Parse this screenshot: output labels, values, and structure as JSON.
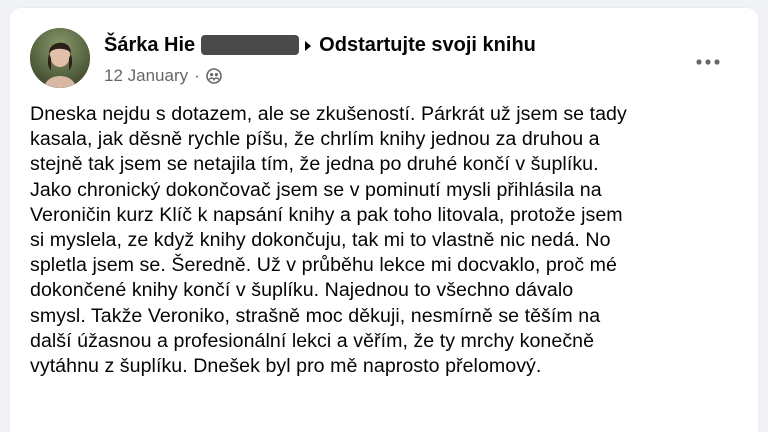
{
  "post": {
    "author_name": "Šárka Hie",
    "group_name": "Odstartujte svoji knihu",
    "timestamp": "12 January",
    "separator": "·",
    "audience_icon": "members-icon",
    "more_icon": "more-options-icon",
    "body": "Dneska nejdu s dotazem, ale se zkušeností. Párkrát už jsem se tady\nkasala, jak děsně rychle píšu, že chrlím knihy jednou za druhou a\nstejně tak jsem se netajila tím, že jedna po druhé končí v šuplíku.\nJako chronický dokončovač jsem se v pominutí mysli přihlásila na\nVeroničin kurz Klíč k napsání knihy a pak toho litovala, protože jsem\nsi myslela, ze když knihy dokončuju, tak mi to vlastně nic nedá. No\nspletla jsem se. Šeredně. Už v průběhu lekce mi docvaklo, proč mé\ndokončené knihy končí v šuplíku. Najednou to všechno dávalo\nsmysl. Takže Veroniko, strašně moc děkuji, nesmírně se těším na\ndalší úžasnou a profesionální lekci a věřím, že ty mrchy konečně\nvytáhnu z šuplíku. Dnešek byl pro mě naprosto přelomový."
  },
  "colors": {
    "text": "#050505",
    "meta": "#65676b",
    "card": "#ffffff",
    "background": "#f0f2f5"
  }
}
